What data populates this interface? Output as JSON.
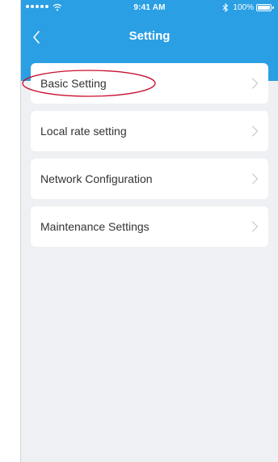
{
  "status_bar": {
    "time": "9:41 AM",
    "battery_text": "100%",
    "signal_dots": 5
  },
  "nav": {
    "title": "Setting",
    "back_icon": "chevron-left-icon"
  },
  "menu": {
    "items": [
      {
        "label": "Basic Setting",
        "icon": "chevron-right-icon",
        "highlighted": true
      },
      {
        "label": "Local rate setting",
        "icon": "chevron-right-icon"
      },
      {
        "label": "Network Configuration",
        "icon": "chevron-right-icon"
      },
      {
        "label": "Maintenance Settings",
        "icon": "chevron-right-icon"
      }
    ]
  },
  "colors": {
    "header_blue": "#2a9fe4",
    "background": "#eff0f3",
    "card": "#ffffff",
    "text": "#333333",
    "chevron": "#c7c7cc",
    "annotation_red": "#c8102e"
  }
}
